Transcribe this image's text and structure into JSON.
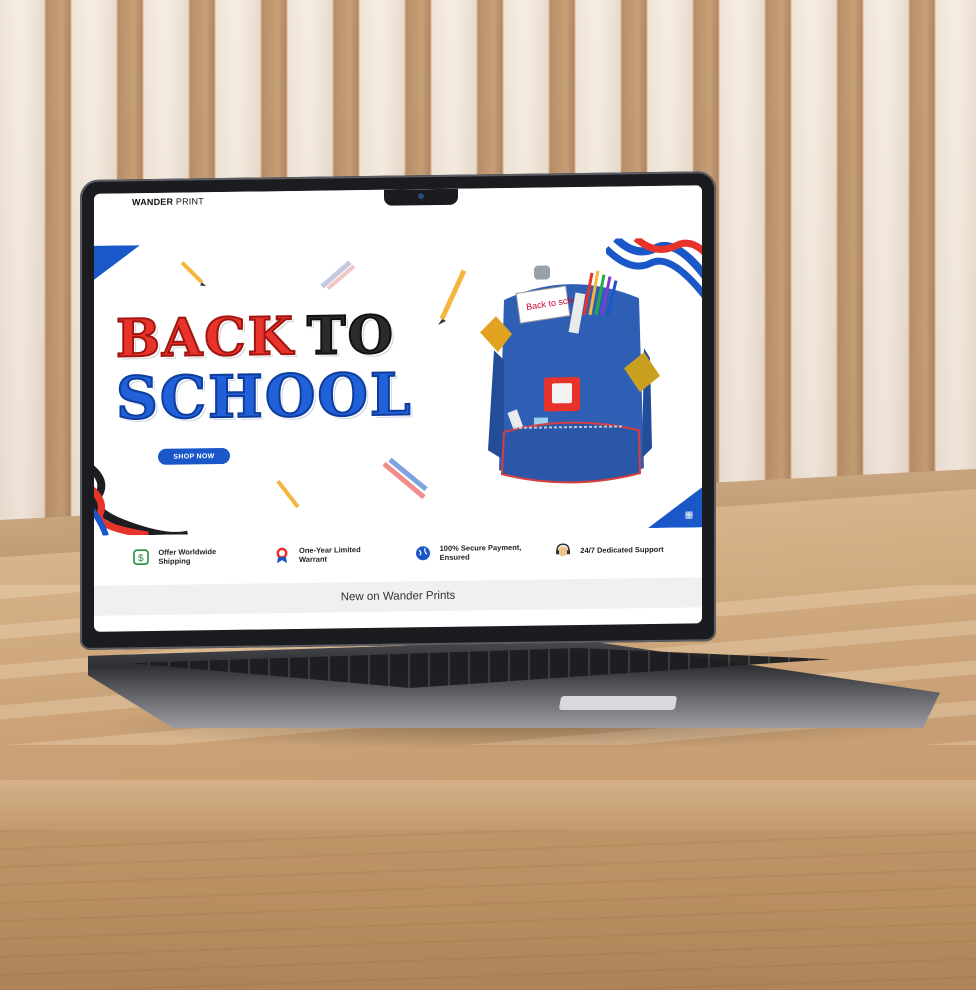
{
  "site": {
    "logo_bold": "WANDER",
    "logo_light": " PRINT"
  },
  "banner": {
    "title_word_1": "BACK",
    "title_word_2": "TO",
    "title_line_2": "SCHOOL",
    "cta_label": "SHOP NOW",
    "notebook_text": "Back to school!",
    "colors": {
      "red": "#e8332a",
      "blue": "#1a57c8",
      "black": "#2b2b2b"
    }
  },
  "features": [
    {
      "icon": "dollar-icon",
      "text": "Offer Worldwide Shipping"
    },
    {
      "icon": "award-ribbon-icon",
      "text": "One-Year Limited Warrant"
    },
    {
      "icon": "globe-icon",
      "text": "100% Secure Payment, Ensured"
    },
    {
      "icon": "support-agent-icon",
      "text": "24/7 Dedicated Support"
    }
  ],
  "section": {
    "new_heading": "New on Wander Prints"
  }
}
